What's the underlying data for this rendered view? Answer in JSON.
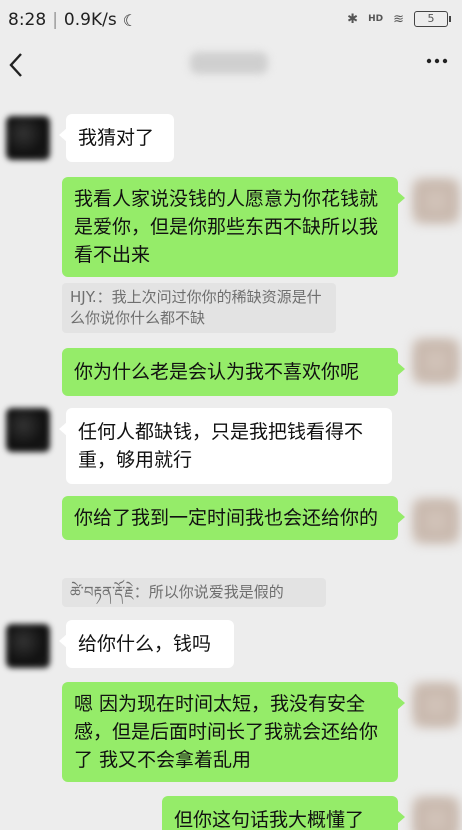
{
  "status": {
    "time": "8:28",
    "speed": "0.9K/s",
    "moon_icon": "moon-icon",
    "hd_label": "HD",
    "battery": "5"
  },
  "nav": {
    "back_icon": "back-arrow-icon",
    "more_icon": "more-icon",
    "back_glyph": "<",
    "more_glyph": "···"
  },
  "messages": {
    "m1": "我猜对了",
    "m2": "我看人家说没钱的人愿意为你花钱就是爱你，但是你那些东西不缺所以我看不出来",
    "q1": "HJY.：我上次问过你你的稀缺资源是什么你说你什么都不缺",
    "m3": "你为什么老是会认为我不喜欢你呢",
    "m4": "任何人都缺钱，只是我把钱看得不重，够用就行",
    "m5": "你给了我到一定时间我也会还给你的",
    "q2": "ཚེ་བརྟན་རྡོ་རྗེ：所以你说爱我是假的",
    "m6": "给你什么，钱吗",
    "m7": "嗯 因为现在时间太短，我没有安全感，但是后面时间长了我就会还给你了 我又不会拿着乱用",
    "m8": "但你这句话我大概懂了"
  },
  "colors": {
    "background": "#ededed",
    "green_bubble": "#95ec69",
    "white_bubble": "#ffffff",
    "quote_bg": "#e3e3e3"
  }
}
